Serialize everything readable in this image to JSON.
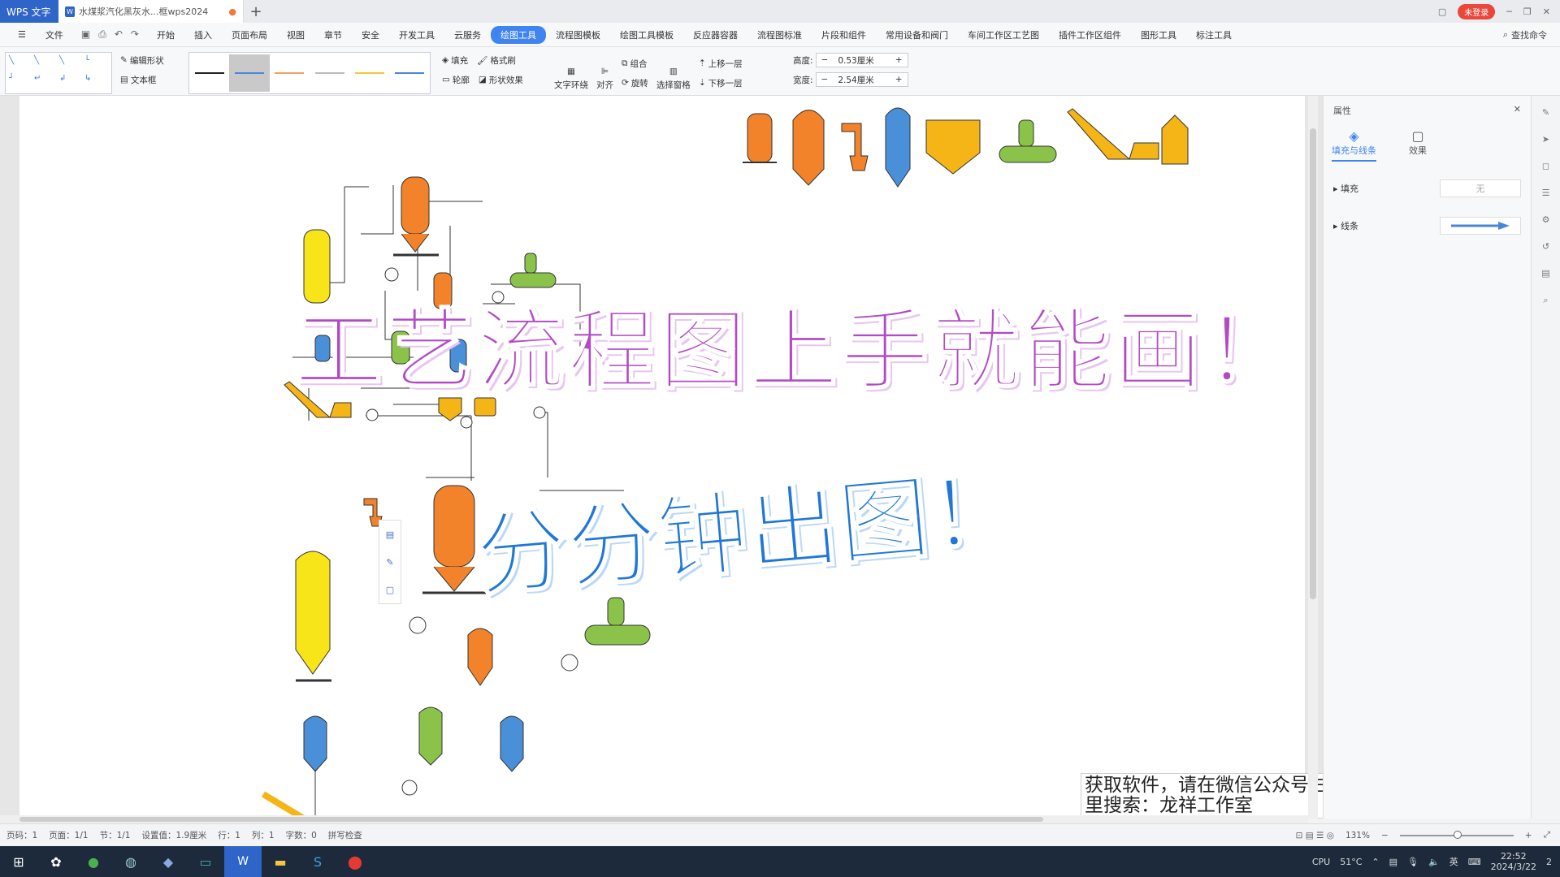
{
  "titlebar": {
    "app_label": "WPS 文字",
    "doc_tab_label": "水煤浆汽化黑灰水...框wps2024",
    "doc_icon_letter": "W",
    "unsaved_dot": "●",
    "new_tab": "+",
    "login_label": "未登录"
  },
  "menubar": {
    "file": "文件",
    "items": [
      "开始",
      "插入",
      "页面布局",
      "视图",
      "章节",
      "安全",
      "开发工具",
      "云服务",
      "绘图工具",
      "流程图模板",
      "绘图工具模板",
      "反应器容器",
      "流程图标准",
      "片段和组件",
      "常用设备和阀门",
      "车间工作区工艺图",
      "插件工作区组件",
      "图形工具",
      "标注工具"
    ],
    "active_index": 8,
    "search_cmd": "查找命令"
  },
  "ribbon": {
    "edit_shape": "编辑形状",
    "text_box": "文本框",
    "fill": "填充",
    "format_brush": "格式刷",
    "outline": "轮廓",
    "shape_effect": "形状效果",
    "text_wrap": "文字环绕",
    "align": "对齐",
    "group": "组合",
    "rotate": "旋转",
    "select_pane": "选择窗格",
    "bring_forward": "上移一层",
    "send_backward": "下移一层",
    "height_label": "高度:",
    "height_value": "0.53厘米",
    "width_label": "宽度:",
    "width_value": "2.54厘米",
    "minus": "−",
    "plus": "+"
  },
  "headlines": {
    "line1": "工艺流程图上手就能画！",
    "line2": "分分钟出图！"
  },
  "watermark": {
    "line1": "获取软件，请在微信公众号右上角添加公众号",
    "line2": "里搜索：龙祥工作室"
  },
  "side_panel": {
    "title": "属性",
    "tab_fill_line": "填充与线条",
    "tab_effect": "效果",
    "fill_label": "填充",
    "fill_value": "无",
    "line_label": "线条",
    "line_color": "#4a86d8"
  },
  "statusbar": {
    "page": "页码：1",
    "pages": "页面：1/1",
    "section": "节：1/1",
    "setting": "设置值：1.9厘米",
    "row": "行：1",
    "col": "列：1",
    "words": "字数：0",
    "spell": "拼写检查",
    "zoom": "131%"
  },
  "taskbar": {
    "cpu": "CPU",
    "temp": "51°C",
    "ime": "英",
    "time": "22:52",
    "date": "2024/3/22",
    "notif_count": "2"
  },
  "colors": {
    "orange": "#f2832a",
    "yellow": "#f7e51a",
    "gold": "#f5b516",
    "blue": "#4a90d9",
    "green": "#8bc34a",
    "purple": "#b24ac6",
    "headline_blue": "#2077d8"
  }
}
